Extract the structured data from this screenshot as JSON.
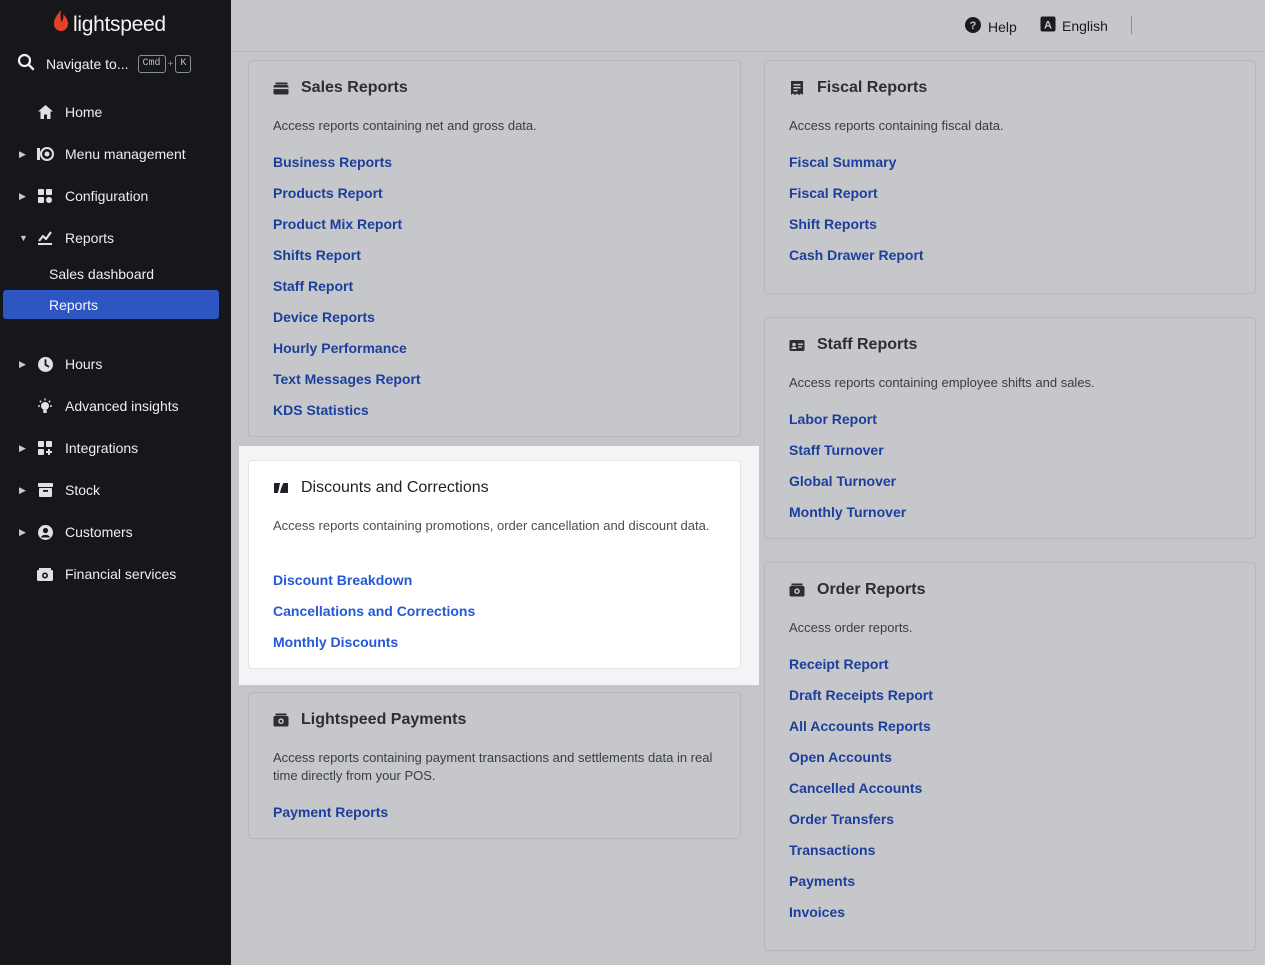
{
  "sidebar": {
    "logo_text": "lightspeed",
    "navigate_label": "Navigate to...",
    "shortcut_key1": "Cmd",
    "shortcut_plus": "+",
    "shortcut_key2": "K",
    "items": [
      {
        "label": "Home",
        "icon": "home-icon"
      },
      {
        "label": "Menu management",
        "icon": "menu-management-icon"
      },
      {
        "label": "Configuration",
        "icon": "configuration-icon"
      },
      {
        "label": "Reports",
        "icon": "reports-icon"
      },
      {
        "label": "Hours",
        "icon": "clock-icon"
      },
      {
        "label": "Advanced insights",
        "icon": "lightbulb-icon"
      },
      {
        "label": "Integrations",
        "icon": "integrations-icon"
      },
      {
        "label": "Stock",
        "icon": "stock-icon"
      },
      {
        "label": "Customers",
        "icon": "customer-icon"
      },
      {
        "label": "Financial services",
        "icon": "financial-services-icon"
      }
    ],
    "sub_items": [
      {
        "label": "Sales dashboard"
      },
      {
        "label": "Reports",
        "active": true
      }
    ]
  },
  "header": {
    "help_label": "Help",
    "language_label": "English"
  },
  "cards": {
    "sales": {
      "title": "Sales Reports",
      "description": "Access reports containing net and gross data.",
      "links": [
        "Business Reports",
        "Products Report",
        "Product Mix Report",
        "Shifts Report",
        "Staff Report",
        "Device Reports",
        "Hourly Performance",
        "Text Messages Report",
        "KDS Statistics"
      ]
    },
    "discounts": {
      "title": "Discounts and Corrections",
      "description": "Access reports containing promotions, order cancellation and discount data.",
      "links": [
        "Discount Breakdown",
        "Cancellations and Corrections",
        "Monthly Discounts"
      ]
    },
    "payments": {
      "title": "Lightspeed Payments",
      "description": "Access reports containing payment transactions and settlements data in real time directly from your POS.",
      "links": [
        "Payment Reports"
      ]
    },
    "fiscal": {
      "title": "Fiscal Reports",
      "description": "Access reports containing fiscal data.",
      "links": [
        "Fiscal Summary",
        "Fiscal Report",
        "Shift Reports",
        "Cash Drawer Report"
      ]
    },
    "staff": {
      "title": "Staff Reports",
      "description": "Access reports containing employee shifts and sales.",
      "links": [
        "Labor Report",
        "Staff Turnover",
        "Global Turnover",
        "Monthly Turnover"
      ]
    },
    "order": {
      "title": "Order Reports",
      "description": "Access order reports.",
      "links": [
        "Receipt Report",
        "Draft Receipts Report",
        "All Accounts Reports",
        "Open Accounts",
        "Cancelled Accounts",
        "Order Transfers",
        "Transactions",
        "Payments",
        "Invoices"
      ]
    }
  },
  "colors": {
    "sidebar_bg": "#15171b",
    "active_item": "#2d56c2",
    "link": "#1c3f9c",
    "link_focused": "#2558d6",
    "brand_flame": "#e4412b"
  }
}
